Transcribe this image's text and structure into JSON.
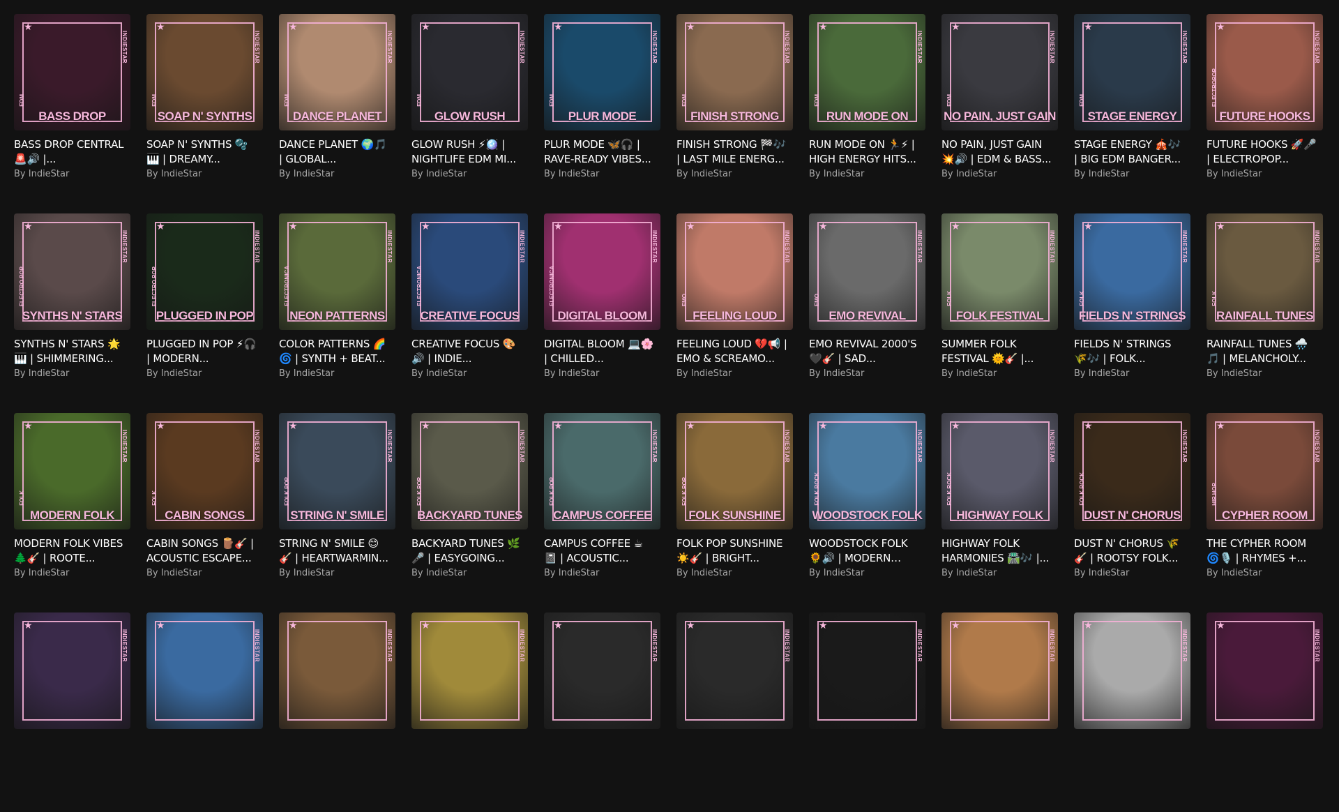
{
  "author_prefix": "By",
  "brand": "INDIESTAR",
  "cards": [
    {
      "cover_title": "BASS DROP",
      "genre": "EDM",
      "title": "BASS DROP CENTRAL 🚨🔊 |...",
      "author": "By IndieStar",
      "bg": "#3a1a2a"
    },
    {
      "cover_title": "SOAP N' SYNTHS",
      "genre": "EDM",
      "title": "SOAP N' SYNTHS 🫧🎹 | DREAMY...",
      "author": "By IndieStar",
      "bg": "#6a4a30"
    },
    {
      "cover_title": "DANCE PLANET",
      "genre": "EDM",
      "title": "DANCE PLANET 🌍🎵 | GLOBAL...",
      "author": "By IndieStar",
      "bg": "#b08a70"
    },
    {
      "cover_title": "GLOW RUSH",
      "genre": "EDM",
      "title": "GLOW RUSH ⚡🪩 | NIGHTLIFE EDM MI...",
      "author": "By IndieStar",
      "bg": "#2a2a30"
    },
    {
      "cover_title": "PLUR MODE",
      "genre": "EDM",
      "title": "PLUR MODE 🦋🎧 | RAVE-READY VIBES...",
      "author": "By IndieStar",
      "bg": "#1a4a6a"
    },
    {
      "cover_title": "FINISH STRONG",
      "genre": "EDM",
      "title": "FINISH STRONG 🏁🎶 | LAST MILE ENERG...",
      "author": "By IndieStar",
      "bg": "#8a6a50"
    },
    {
      "cover_title": "RUN MODE ON",
      "genre": "EDM",
      "title": "RUN MODE ON 🏃⚡ | HIGH ENERGY HITS...",
      "author": "By IndieStar",
      "bg": "#4a6a3a"
    },
    {
      "cover_title": "NO PAIN, JUST GAIN",
      "genre": "EDM",
      "title": "NO PAIN, JUST GAIN 💥🔊 | EDM & BASS...",
      "author": "By IndieStar",
      "bg": "#3a3a40"
    },
    {
      "cover_title": "STAGE ENERGY",
      "genre": "EDM",
      "title": "STAGE ENERGY 🎪🎶 | BIG EDM BANGER...",
      "author": "By IndieStar",
      "bg": "#2a3a4a"
    },
    {
      "cover_title": "FUTURE HOOKS",
      "genre": "ELECTROPOP",
      "title": "FUTURE HOOKS 🚀🎤 | ELECTROPOP...",
      "author": "By IndieStar",
      "bg": "#9a5a4a"
    },
    {
      "cover_title": "SYNTHS N' STARS",
      "genre": "ELECTRO POP",
      "title": "SYNTHS N' STARS 🌟🎹 | SHIMMERING...",
      "author": "By IndieStar",
      "bg": "#5a4a4a"
    },
    {
      "cover_title": "PLUGGED IN POP",
      "genre": "ELECTRO POP",
      "title": "PLUGGED IN POP ⚡🎧 | MODERN...",
      "author": "By IndieStar",
      "bg": "#1a2a1a"
    },
    {
      "cover_title": "NEON PATTERNS",
      "genre": "ELECTRONICA",
      "title": "COLOR PATTERNS 🌈🌀 | SYNTH + BEAT...",
      "author": "By IndieStar",
      "bg": "#5a6a3a"
    },
    {
      "cover_title": "CREATIVE FOCUS",
      "genre": "ELECTRONICA",
      "title": "CREATIVE FOCUS 🎨🔊 | INDIE...",
      "author": "By IndieStar",
      "bg": "#2a4a7a"
    },
    {
      "cover_title": "DIGITAL BLOOM",
      "genre": "ELECTRONICA",
      "title": "DIGITAL BLOOM 💻🌸 | CHILLED...",
      "author": "By IndieStar",
      "bg": "#a03070"
    },
    {
      "cover_title": "FEELING LOUD",
      "genre": "EMO",
      "title": "FEELING LOUD 💔📢 | EMO & SCREAMO...",
      "author": "By IndieStar",
      "bg": "#c07a68"
    },
    {
      "cover_title": "EMO REVIVAL",
      "genre": "EMO",
      "title": "EMO REVIVAL 2000'S 🖤🎸 | SAD...",
      "author": "By IndieStar",
      "bg": "#6a6a6a"
    },
    {
      "cover_title": "FOLK FESTIVAL",
      "genre": "FOLK",
      "title": "SUMMER FOLK FESTIVAL 🌞🎸 |...",
      "author": "By IndieStar",
      "bg": "#7a8a6a"
    },
    {
      "cover_title": "FIELDS N' STRINGS",
      "genre": "FOLK",
      "title": "FIELDS N' STRINGS 🌾🎶 | FOLK...",
      "author": "By IndieStar",
      "bg": "#3a6aa0"
    },
    {
      "cover_title": "RAINFALL TUNES",
      "genre": "FOLK",
      "title": "RAINFALL TUNES 🌧️🎵 | MELANCHOLY...",
      "author": "By IndieStar",
      "bg": "#6a5a40"
    },
    {
      "cover_title": "MODERN FOLK",
      "genre": "FOLK",
      "title": "MODERN FOLK VIBES 🌲🎸 | ROOTE...",
      "author": "By IndieStar",
      "bg": "#4a6a2a"
    },
    {
      "cover_title": "CABIN SONGS",
      "genre": "FOLK",
      "title": "CABIN SONGS 🪵🎸 | ACOUSTIC ESCAPE...",
      "author": "By IndieStar",
      "bg": "#5a3a20"
    },
    {
      "cover_title": "STRING N' SMILE",
      "genre": "FOLK POP",
      "title": "STRING N' SMILE 😊🎸 | HEARTWARMIN...",
      "author": "By IndieStar",
      "bg": "#3a4a5a"
    },
    {
      "cover_title": "BACKYARD TUNES",
      "genre": "FOLK POP",
      "title": "BACKYARD TUNES 🌿🎤 | EASYGOING...",
      "author": "By IndieStar",
      "bg": "#5a5a4a"
    },
    {
      "cover_title": "CAMPUS COFFEE",
      "genre": "FOLK POP",
      "title": "CAMPUS COFFEE ☕📓 | ACOUSTIC...",
      "author": "By IndieStar",
      "bg": "#4a6a6a"
    },
    {
      "cover_title": "FOLK SUNSHINE",
      "genre": "FOLK POP",
      "title": "FOLK POP SUNSHINE ☀️🎸 | BRIGHT...",
      "author": "By IndieStar",
      "bg": "#8a6a3a"
    },
    {
      "cover_title": "WOODSTOCK FOLK",
      "genre": "FOLK ROCK",
      "title": "WOODSTOCK FOLK 🌻🔊 | MODERN FOL...",
      "author": "By IndieStar",
      "bg": "#4a7aa0"
    },
    {
      "cover_title": "HIGHWAY FOLK",
      "genre": "FOLK ROCK",
      "title": "HIGHWAY FOLK HARMONIES 🛣️🎶 |...",
      "author": "By IndieStar",
      "bg": "#5a5a6a"
    },
    {
      "cover_title": "DUST N' CHORUS",
      "genre": "FOLK ROCK",
      "title": "DUST N' CHORUS 🌾🎸 | ROOTSY FOLK...",
      "author": "By IndieStar",
      "bg": "#3a2a1a"
    },
    {
      "cover_title": "CYPHER ROOM",
      "genre": "HIP HOP",
      "title": "THE CYPHER ROOM 🌀🎙️ | RHYMES +...",
      "author": "By IndieStar",
      "bg": "#7a4a3a"
    },
    {
      "cover_title": "",
      "genre": "",
      "title": "",
      "author": "",
      "bg": "#3a2a4a"
    },
    {
      "cover_title": "",
      "genre": "",
      "title": "",
      "author": "",
      "bg": "#3a6aa0"
    },
    {
      "cover_title": "",
      "genre": "",
      "title": "",
      "author": "",
      "bg": "#7a5a3a"
    },
    {
      "cover_title": "",
      "genre": "",
      "title": "",
      "author": "",
      "bg": "#a08a3a"
    },
    {
      "cover_title": "",
      "genre": "",
      "title": "",
      "author": "",
      "bg": "#2a2a2a"
    },
    {
      "cover_title": "",
      "genre": "",
      "title": "",
      "author": "",
      "bg": "#2a2a2a"
    },
    {
      "cover_title": "",
      "genre": "",
      "title": "",
      "author": "",
      "bg": "#1a1a1a"
    },
    {
      "cover_title": "",
      "genre": "",
      "title": "",
      "author": "",
      "bg": "#b07a4a"
    },
    {
      "cover_title": "",
      "genre": "",
      "title": "",
      "author": "",
      "bg": "#aaaaaa"
    },
    {
      "cover_title": "",
      "genre": "",
      "title": "",
      "author": "",
      "bg": "#4a1a3a"
    }
  ]
}
